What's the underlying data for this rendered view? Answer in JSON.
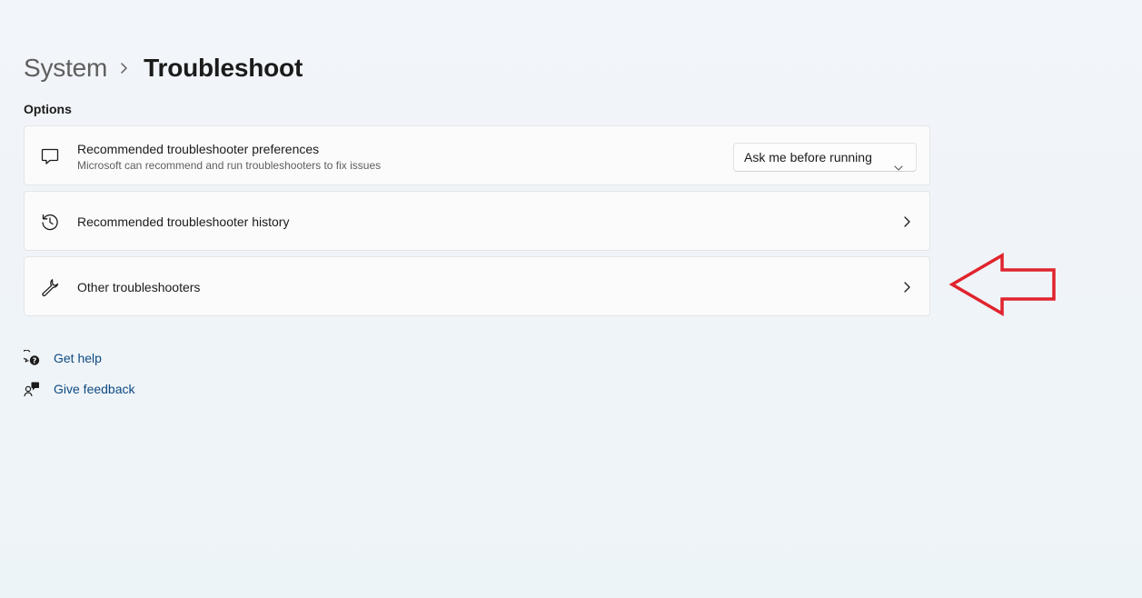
{
  "breadcrumb": {
    "parent": "System",
    "current": "Troubleshoot"
  },
  "section": {
    "label": "Options"
  },
  "cards": [
    {
      "title": "Recommended troubleshooter preferences",
      "subtitle": "Microsoft can recommend and run troubleshooters to fix issues",
      "icon": "speech-bubble-icon",
      "dropdown_value": "Ask me before running"
    },
    {
      "title": "Recommended troubleshooter history",
      "icon": "history-icon"
    },
    {
      "title": "Other troubleshooters",
      "icon": "wrench-icon"
    }
  ],
  "links": {
    "get_help": "Get help",
    "give_feedback": "Give feedback"
  },
  "colors": {
    "link": "#0f4a82",
    "annotation_arrow": "#e0232d",
    "card_background": "#fbfbfc",
    "page_background": "#f2f5f9"
  }
}
